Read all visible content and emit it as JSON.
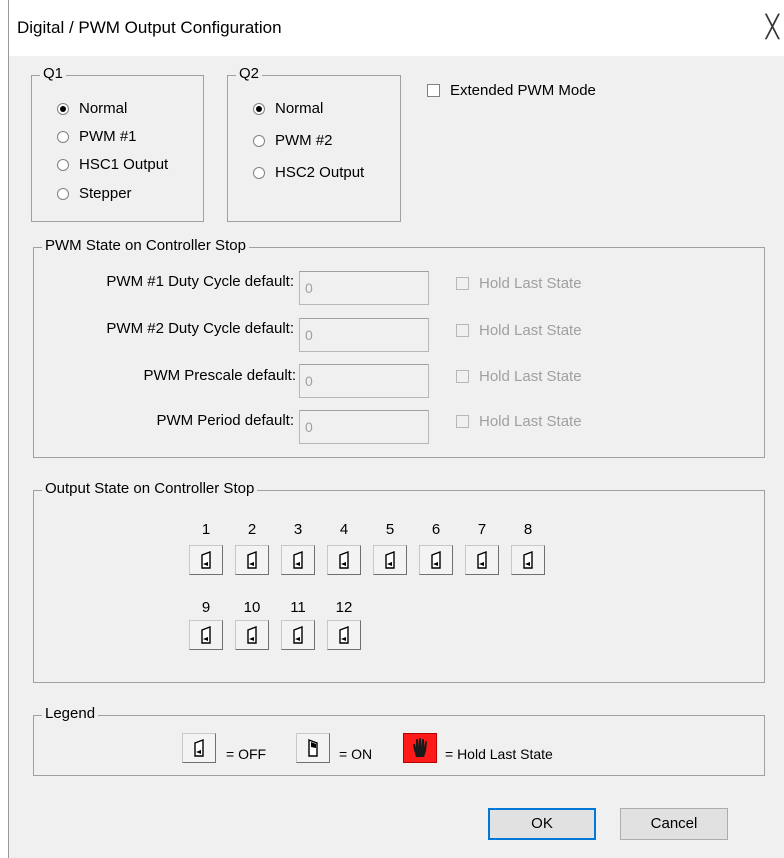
{
  "window": {
    "title": "Digital / PWM Output Configuration",
    "close_glyph": "╳"
  },
  "q1": {
    "label": "Q1",
    "options": [
      "Normal",
      "PWM #1",
      "HSC1 Output",
      "Stepper"
    ],
    "selected": "Normal"
  },
  "q2": {
    "label": "Q2",
    "options": [
      "Normal",
      "PWM #2",
      "HSC2 Output"
    ],
    "selected": "Normal"
  },
  "extended_pwm": {
    "label": "Extended PWM Mode",
    "checked": false
  },
  "pwm_state": {
    "label": "PWM State on Controller Stop",
    "rows": [
      {
        "label": "PWM #1 Duty Cycle default:",
        "value": "0",
        "hold_label": "Hold Last State"
      },
      {
        "label": "PWM #2 Duty Cycle default:",
        "value": "0",
        "hold_label": "Hold Last State"
      },
      {
        "label": "PWM Prescale default:",
        "value": "0",
        "hold_label": "Hold Last State"
      },
      {
        "label": "PWM Period default:",
        "value": "0",
        "hold_label": "Hold Last State"
      }
    ]
  },
  "output_state": {
    "label": "Output State on Controller Stop",
    "outputs": [
      "1",
      "2",
      "3",
      "4",
      "5",
      "6",
      "7",
      "8",
      "9",
      "10",
      "11",
      "12"
    ],
    "state": "off"
  },
  "legend": {
    "label": "Legend",
    "off_text": "= OFF",
    "on_text": "= ON",
    "hold_text": "= Hold Last State"
  },
  "buttons": {
    "ok": "OK",
    "cancel": "Cancel"
  }
}
